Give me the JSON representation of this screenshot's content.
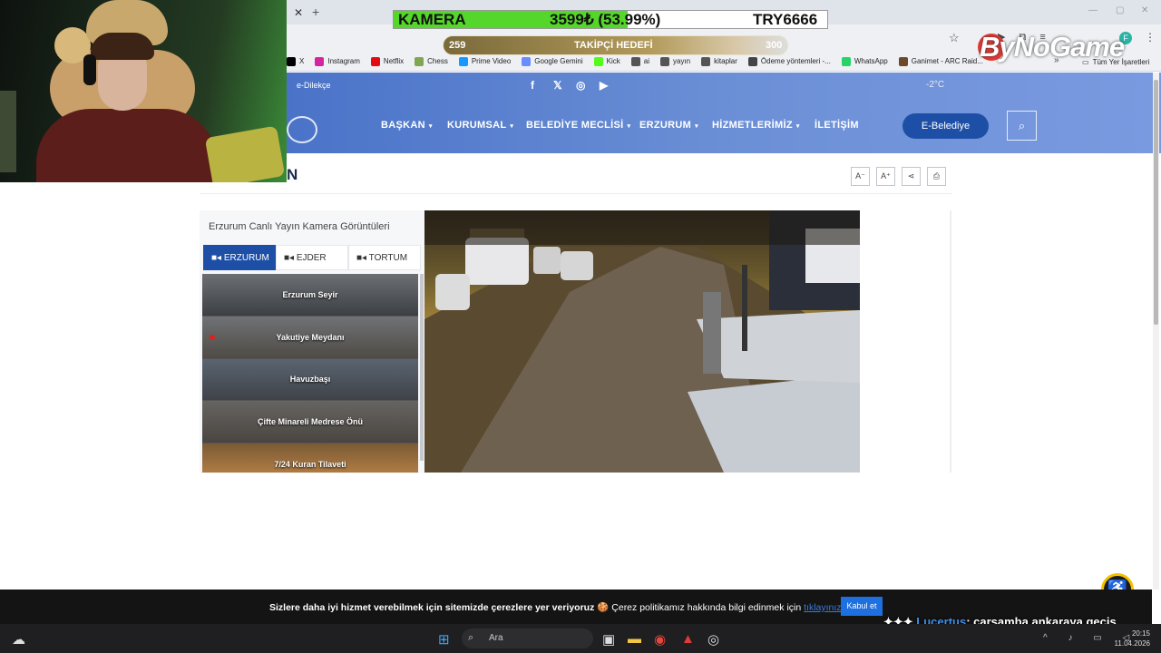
{
  "overlay": {
    "kamera_label": "KAMERA",
    "kamera_amount": "3599₺ (53.99%)",
    "kamera_goal": "TRY6666",
    "kamera_progress": 0.5399,
    "follow_start": "259",
    "follow_label": "TAKİPÇİ HEDEFİ",
    "follow_end": "300",
    "sponsor": "ByNoGame"
  },
  "browser": {
    "bookmarks": [
      {
        "label": "X",
        "icon": "x-icon",
        "color": "#000000"
      },
      {
        "label": "Instagram",
        "icon": "instagram-icon",
        "color": "#d6249f"
      },
      {
        "label": "Netflix",
        "icon": "netflix-icon",
        "color": "#e50914"
      },
      {
        "label": "Chess",
        "icon": "chess-icon",
        "color": "#7fa650"
      },
      {
        "label": "Prime Video",
        "icon": "prime-video-icon",
        "color": "#1399ff"
      },
      {
        "label": "Google Gemini",
        "icon": "gemini-icon",
        "color": "#6a8cff"
      },
      {
        "label": "Kick",
        "icon": "kick-icon",
        "color": "#53fc18"
      },
      {
        "label": "ai",
        "icon": "folder-icon",
        "color": "#555555"
      },
      {
        "label": "yayın",
        "icon": "folder-icon",
        "color": "#555555"
      },
      {
        "label": "kitaplar",
        "icon": "folder-icon",
        "color": "#555555"
      },
      {
        "label": "Ödeme yöntemleri -...",
        "icon": "bookmark-icon",
        "color": "#444444"
      },
      {
        "label": "WhatsApp",
        "icon": "whatsapp-icon",
        "color": "#25d366"
      },
      {
        "label": "Ganimet - ARC Raid...",
        "icon": "ganimet-icon",
        "color": "#6b4a2a"
      }
    ],
    "other_bookmarks": "Tüm Yer İşaretleri"
  },
  "site": {
    "e_dilekce": "e-Dilekçe",
    "temperature": "-2°C",
    "nav": [
      "BAŞKAN",
      "KURUMSAL",
      "BELEDİYE MECLİSİ",
      "ERZURUM",
      "HİZMETLERİMİZ",
      "İLETİŞİM"
    ],
    "ebelediye": "E-Belediye",
    "page_title_fragment": "N",
    "font_small": "A",
    "font_large": "A",
    "panel_title": "Erzurum Canlı Yayın Kamera Görüntüleri",
    "tabs": [
      "ERZURUM",
      "EJDER",
      "TORTUM"
    ],
    "cameras": [
      "Erzurum Seyir",
      "Yakutiye Meydanı",
      "Havuzbaşı",
      "Çifte Minareli Medrese Önü",
      "7/24 Kuran Tilaveti"
    ]
  },
  "cookie": {
    "main": "Sizlere daha iyi hizmet verebilmek için sitemizde çerezlere yer veriyoruz",
    "emoji": "🍪",
    "info": "Çerez politikamız hakkında bilgi edinmek için",
    "link": "tıklayınız",
    "accept": "Kabul et"
  },
  "chat": {
    "user": "Lucertus",
    "message": ": çarşamba ankaraya geçiş yapmam için dua zinciri"
  },
  "taskbar": {
    "search_placeholder": "Ara",
    "time": "20:15",
    "date": "11.04.2026"
  }
}
